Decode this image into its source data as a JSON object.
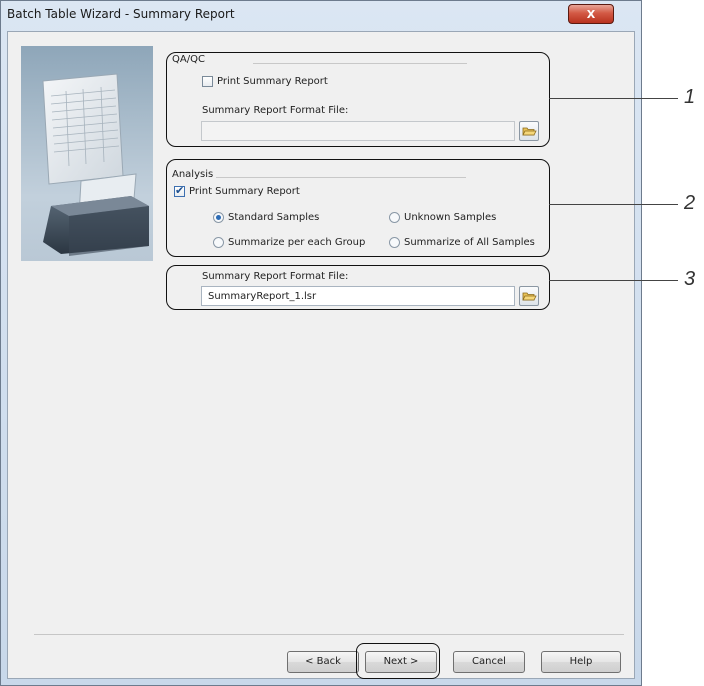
{
  "window": {
    "title": "Batch Table Wizard - Summary Report",
    "close_label": "X"
  },
  "qaqc": {
    "group_label": "QA/QC",
    "print_checkbox": {
      "label": "Print Summary Report",
      "checked": false
    },
    "format_file_label": "Summary Report Format File:",
    "format_file_value": ""
  },
  "analysis": {
    "group_label": "Analysis",
    "print_checkbox": {
      "label": "Print Summary Report",
      "checked": true
    },
    "radios": [
      {
        "label": "Standard Samples",
        "selected": true
      },
      {
        "label": "Unknown Samples",
        "selected": false
      },
      {
        "label": "Summarize per each Group",
        "selected": false
      },
      {
        "label": "Summarize of All Samples",
        "selected": false
      }
    ]
  },
  "summary_format": {
    "label": "Summary Report Format File:",
    "value": "SummaryReport_1.lsr"
  },
  "callouts": [
    "1",
    "2",
    "3"
  ],
  "buttons": {
    "back": "< Back",
    "next": "Next >",
    "cancel": "Cancel",
    "help": "Help"
  },
  "colors": {
    "accent": "#2d6cb5",
    "close": "#c7432e"
  }
}
